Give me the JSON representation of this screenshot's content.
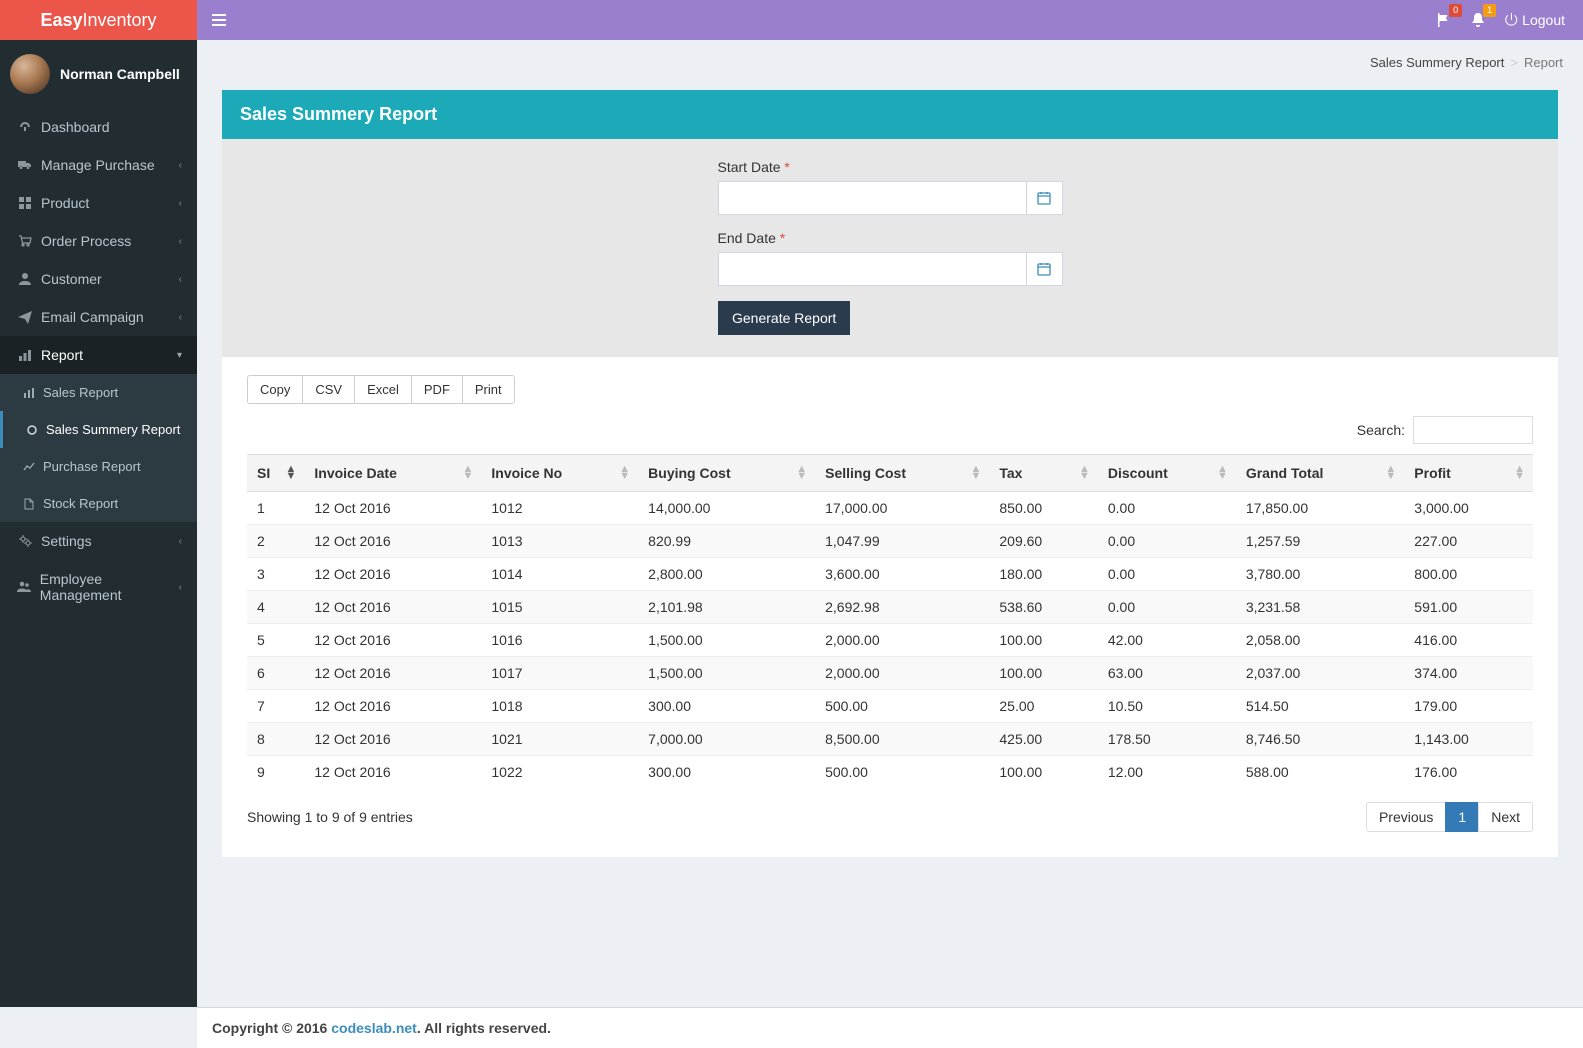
{
  "brand": {
    "bold": "Easy",
    "light": "Inventory"
  },
  "user": {
    "name": "Norman Campbell"
  },
  "topbar": {
    "flag_badge": "0",
    "bell_badge": "1",
    "logout": "Logout"
  },
  "breadcrumb": {
    "a": "Sales Summery Report",
    "b": "Report"
  },
  "sidebar": {
    "items": [
      {
        "label": "Dashboard",
        "icon": "dashboard"
      },
      {
        "label": "Manage Purchase",
        "icon": "truck",
        "expandable": true
      },
      {
        "label": "Product",
        "icon": "grid",
        "expandable": true
      },
      {
        "label": "Order Process",
        "icon": "cart",
        "expandable": true
      },
      {
        "label": "Customer",
        "icon": "user",
        "expandable": true
      },
      {
        "label": "Email Campaign",
        "icon": "send",
        "expandable": true
      },
      {
        "label": "Report",
        "icon": "bars",
        "expandable": true,
        "open": true,
        "children": [
          {
            "label": "Sales Report",
            "icon": "chart"
          },
          {
            "label": "Sales Summery Report",
            "icon": "circle",
            "active": true
          },
          {
            "label": "Purchase Report",
            "icon": "line"
          },
          {
            "label": "Stock Report",
            "icon": "doc"
          }
        ]
      },
      {
        "label": "Settings",
        "icon": "cogs",
        "expandable": true
      },
      {
        "label": "Employee Management",
        "icon": "users",
        "expandable": true
      }
    ]
  },
  "panel": {
    "title": "Sales Summery Report",
    "start_label": "Start Date",
    "end_label": "End Date",
    "generate": "Generate Report"
  },
  "export": {
    "copy": "Copy",
    "csv": "CSV",
    "excel": "Excel",
    "pdf": "PDF",
    "print": "Print"
  },
  "search_label": "Search:",
  "table": {
    "headers": [
      "SI",
      "Invoice Date",
      "Invoice No",
      "Buying Cost",
      "Selling Cost",
      "Tax",
      "Discount",
      "Grand Total",
      "Profit"
    ],
    "rows": [
      [
        "1",
        "12 Oct 2016",
        "1012",
        "14,000.00",
        "17,000.00",
        "850.00",
        "0.00",
        "17,850.00",
        "3,000.00"
      ],
      [
        "2",
        "12 Oct 2016",
        "1013",
        "820.99",
        "1,047.99",
        "209.60",
        "0.00",
        "1,257.59",
        "227.00"
      ],
      [
        "3",
        "12 Oct 2016",
        "1014",
        "2,800.00",
        "3,600.00",
        "180.00",
        "0.00",
        "3,780.00",
        "800.00"
      ],
      [
        "4",
        "12 Oct 2016",
        "1015",
        "2,101.98",
        "2,692.98",
        "538.60",
        "0.00",
        "3,231.58",
        "591.00"
      ],
      [
        "5",
        "12 Oct 2016",
        "1016",
        "1,500.00",
        "2,000.00",
        "100.00",
        "42.00",
        "2,058.00",
        "416.00"
      ],
      [
        "6",
        "12 Oct 2016",
        "1017",
        "1,500.00",
        "2,000.00",
        "100.00",
        "63.00",
        "2,037.00",
        "374.00"
      ],
      [
        "7",
        "12 Oct 2016",
        "1018",
        "300.00",
        "500.00",
        "25.00",
        "10.50",
        "514.50",
        "179.00"
      ],
      [
        "8",
        "12 Oct 2016",
        "1021",
        "7,000.00",
        "8,500.00",
        "425.00",
        "178.50",
        "8,746.50",
        "1,143.00"
      ],
      [
        "9",
        "12 Oct 2016",
        "1022",
        "300.00",
        "500.00",
        "100.00",
        "12.00",
        "588.00",
        "176.00"
      ]
    ],
    "info": "Showing 1 to 9 of 9 entries"
  },
  "pagination": {
    "prev": "Previous",
    "page": "1",
    "next": "Next"
  },
  "footer": {
    "copyright": "Copyright © 2016 ",
    "link": "codeslab.net",
    "tail": ". All rights reserved."
  }
}
